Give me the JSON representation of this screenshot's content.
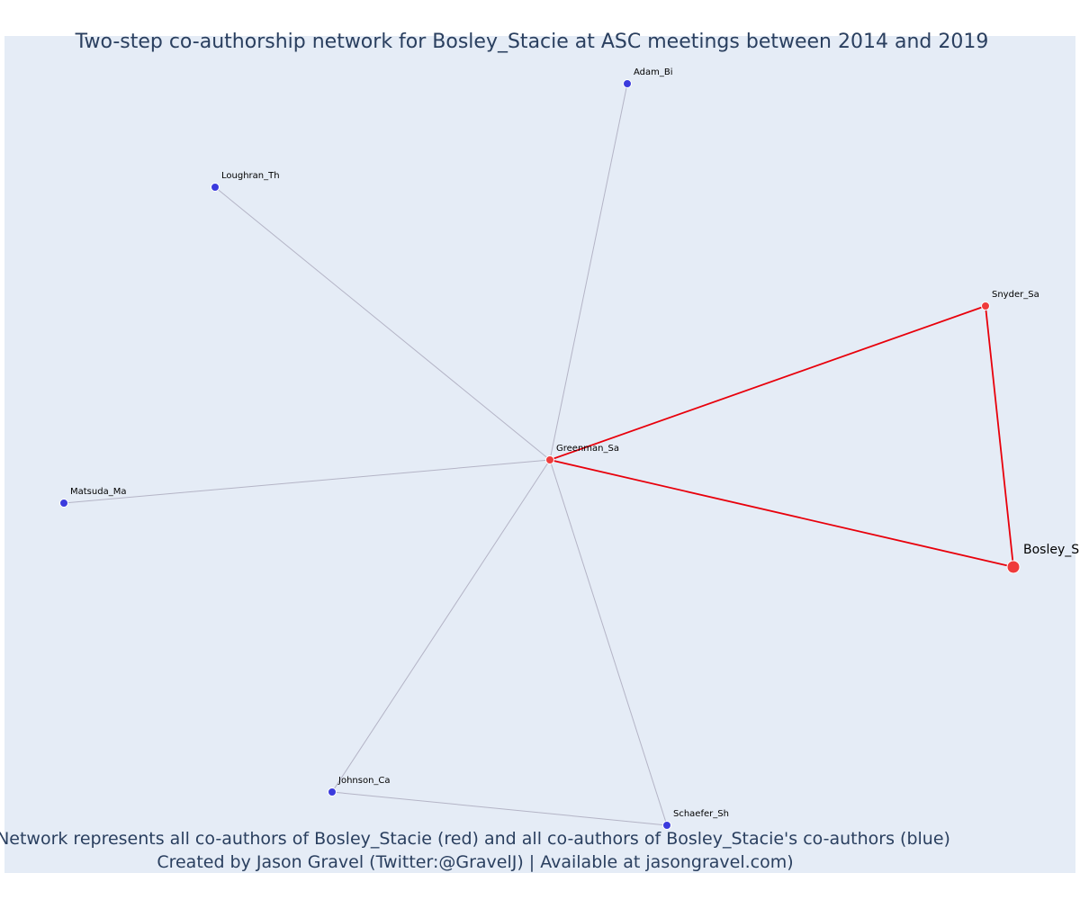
{
  "title": "Two-step co-authorship network for Bosley_Stacie at ASC meetings between 2014 and 2019",
  "caption": {
    "line1": "Network represents all co-authors of Bosley_Stacie (red) and all co-authors of Bosley_Stacie's co-authors (blue)",
    "line2": "Created by Jason Gravel (Twitter:@GravelJ) | Available at jasongravel.com)"
  },
  "colors": {
    "background": "#e5ecf6",
    "text": "#2a3f5f",
    "red_node": "#ef3b3b",
    "blue_node": "#3b3bdd",
    "red_edge": "#e8000b",
    "gray_edge": "#b4b4c6"
  },
  "nodes": [
    {
      "id": "bosley",
      "label": "Bosley_S",
      "group": "focal"
    },
    {
      "id": "greenman",
      "label": "Greenman_Sa",
      "group": "red"
    },
    {
      "id": "snyder",
      "label": "Snyder_Sa",
      "group": "red"
    },
    {
      "id": "adam",
      "label": "Adam_Bi",
      "group": "blue"
    },
    {
      "id": "loughran",
      "label": "Loughran_Th",
      "group": "blue"
    },
    {
      "id": "matsuda",
      "label": "Matsuda_Ma",
      "group": "blue"
    },
    {
      "id": "johnson",
      "label": "Johnson_Ca",
      "group": "blue"
    },
    {
      "id": "schaefer",
      "label": "Schaefer_Sh",
      "group": "blue"
    }
  ],
  "edges": [
    {
      "source": "greenman",
      "target": "adam",
      "type": "gray"
    },
    {
      "source": "greenman",
      "target": "loughran",
      "type": "gray"
    },
    {
      "source": "greenman",
      "target": "matsuda",
      "type": "gray"
    },
    {
      "source": "greenman",
      "target": "johnson",
      "type": "gray"
    },
    {
      "source": "greenman",
      "target": "schaefer",
      "type": "gray"
    },
    {
      "source": "johnson",
      "target": "schaefer",
      "type": "gray"
    },
    {
      "source": "greenman",
      "target": "snyder",
      "type": "red"
    },
    {
      "source": "greenman",
      "target": "bosley",
      "type": "red"
    },
    {
      "source": "snyder",
      "target": "bosley",
      "type": "red"
    }
  ]
}
